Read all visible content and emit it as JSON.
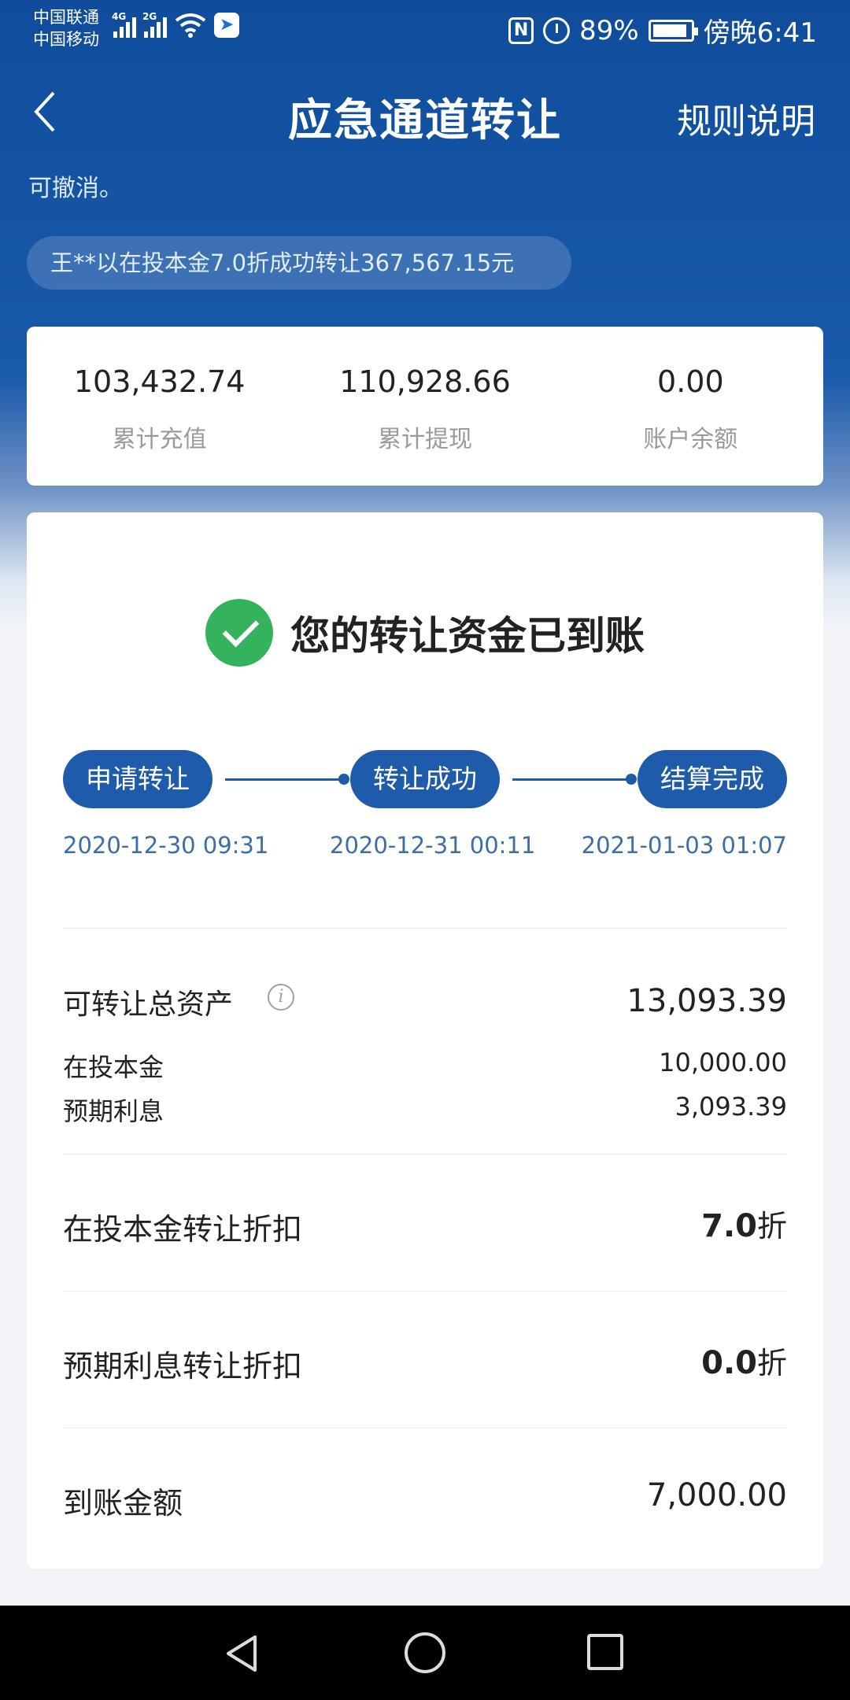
{
  "status_bar": {
    "carrier1": "中国联通",
    "carrier2": "中国移动",
    "net1": "4G",
    "net2": "2G",
    "nfc": "N",
    "battery": "89%",
    "time": "傍晚6:41"
  },
  "header": {
    "title": "应急通道转让",
    "rules_link": "规则说明"
  },
  "note": "可撤消。",
  "ticker": "王**以在投本金7.0折成功转让367,567.15元",
  "stats": [
    {
      "value": "103,432.74",
      "label": "累计充值"
    },
    {
      "value": "110,928.66",
      "label": "累计提现"
    },
    {
      "value": "0.00",
      "label": "账户余额"
    }
  ],
  "success_message": "您的转让资金已到账",
  "steps": [
    {
      "label": "申请转让",
      "date": "2020-12-30 09:31"
    },
    {
      "label": "转让成功",
      "date": "2020-12-31 00:11"
    },
    {
      "label": "结算完成",
      "date": "2021-01-03 01:07"
    }
  ],
  "details": {
    "total_label": "可转让总资产",
    "total_value": "13,093.39",
    "principal_label": "在投本金",
    "principal_value": "10,000.00",
    "interest_label": "预期利息",
    "interest_value": "3,093.39",
    "principal_discount_label": "在投本金转让折扣",
    "principal_discount_value": "7.0",
    "interest_discount_label": "预期利息转让折扣",
    "interest_discount_value": "0.0",
    "discount_unit": "折",
    "arrival_label": "到账金额",
    "arrival_value": "7,000.00"
  },
  "colors": {
    "header_blue": "#0f4d9c",
    "step_blue": "#1f5bab",
    "success_green": "#35b35c"
  }
}
